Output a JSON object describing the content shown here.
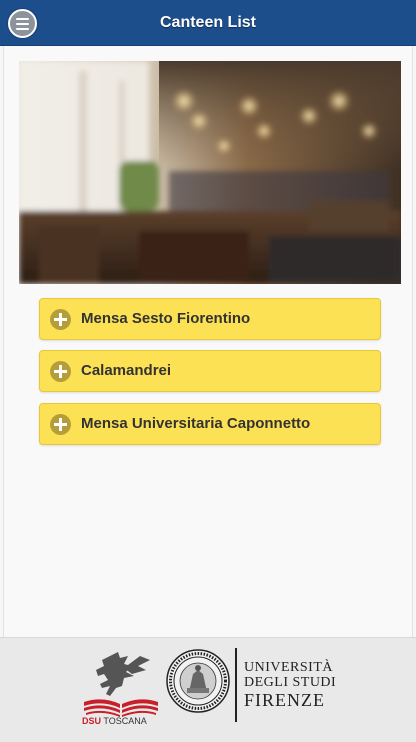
{
  "header": {
    "title": "Canteen List",
    "color": "#1d4e8c"
  },
  "menu": {
    "icon": "hamburger-menu-icon"
  },
  "hero": {
    "icon": "restaurant-photo"
  },
  "canteens": [
    {
      "label": "Mensa Sesto Fiorentino",
      "icon": "plus-circle-icon"
    },
    {
      "label": "Calamandrei",
      "icon": "plus-circle-icon"
    },
    {
      "label": "Mensa Universitaria Caponnetto",
      "icon": "plus-circle-icon"
    }
  ],
  "colors": {
    "item_background": "#fde154",
    "item_icon": "#b59e3a",
    "footer_background": "#e9e9e9"
  },
  "footer": {
    "dsu": {
      "bold": "DSU",
      "rest": "TOSCANA"
    },
    "unifi": {
      "line1": "UNIVERSITÀ",
      "line2": "DEGLI STUDI",
      "line3": "FIRENZE"
    }
  }
}
